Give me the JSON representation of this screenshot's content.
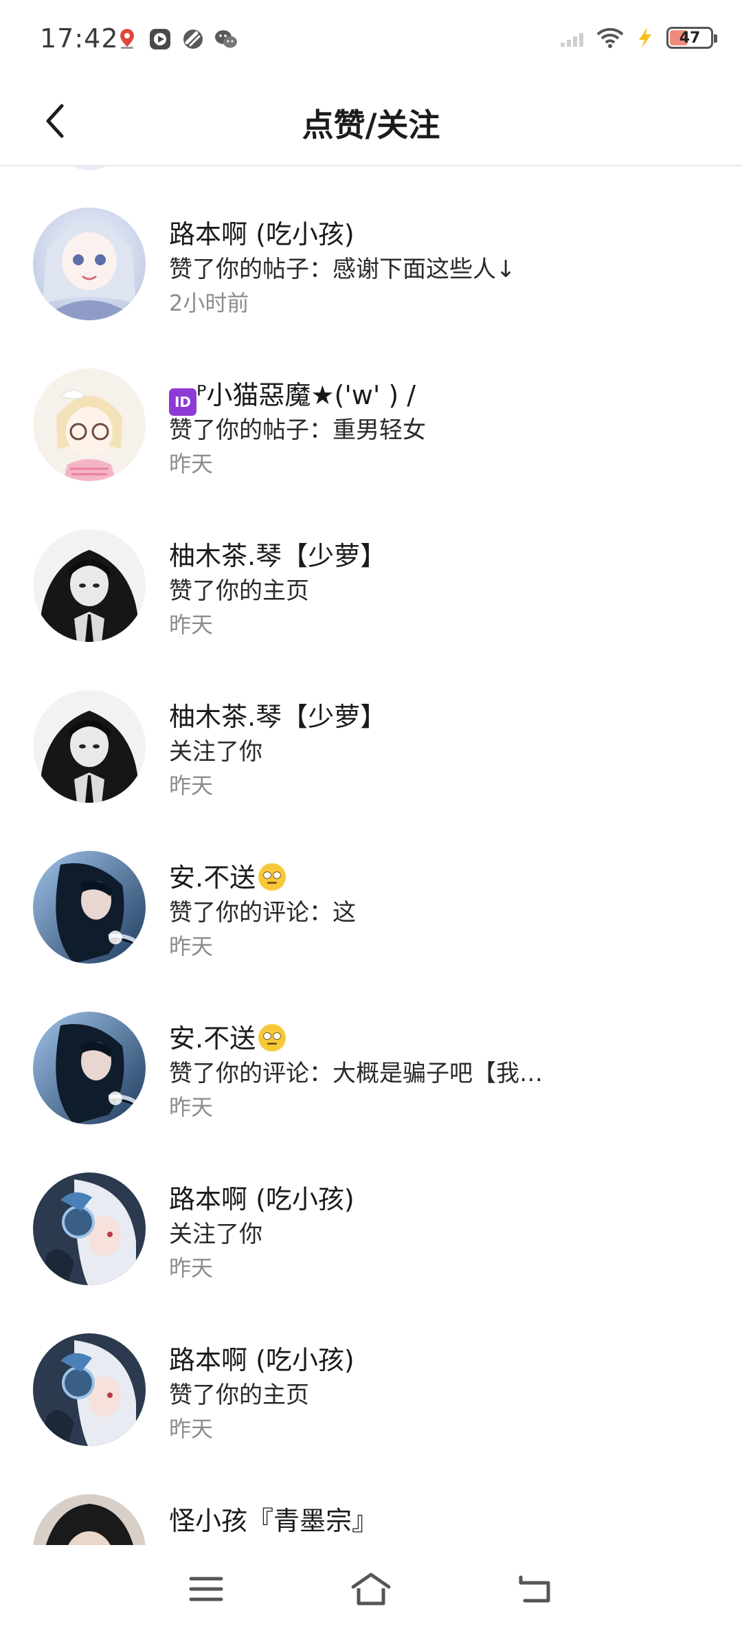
{
  "status_bar": {
    "time": "17:42",
    "battery": "47",
    "left_icons": [
      "location-icon",
      "video-app-icon",
      "capsule-app-icon",
      "wechat-icon"
    ],
    "right_icons": [
      "signal-icon",
      "wifi-icon",
      "charging-icon",
      "battery-icon"
    ]
  },
  "header": {
    "title": "点赞/关注",
    "back_icon": "chevron-left-icon"
  },
  "colors": {
    "text_primary": "#1a1a1a",
    "text_secondary": "#8c8c8c",
    "divider": "#e8e8e8",
    "id_badge": "#8e3ad6"
  },
  "items": [
    {
      "name": "路本啊 (吃小孩)",
      "action": "赞了你的帖子：感谢下面这些人↓",
      "time": "2小时前"
    },
    {
      "badge": "ID",
      "name": "ᴾ小猫惡魔★('w' ) /",
      "action": "赞了你的帖子：重男轻女",
      "time": "昨天"
    },
    {
      "name": "柚木茶.琴【少萝】",
      "action": "赞了你的主页",
      "time": "昨天"
    },
    {
      "name": "柚木茶.琴【少萝】",
      "action": "关注了你",
      "time": "昨天"
    },
    {
      "name": "安.不送",
      "emoji": "rolling-eyes-emoji",
      "action": "赞了你的评论：这",
      "time": "昨天"
    },
    {
      "name": "安.不送",
      "emoji": "rolling-eyes-emoji",
      "action": "赞了你的评论：大概是骗子吧【我…",
      "time": "昨天"
    },
    {
      "name": "路本啊 (吃小孩)",
      "action": "关注了你",
      "time": "昨天"
    },
    {
      "name": "路本啊 (吃小孩)",
      "action": "赞了你的主页",
      "time": "昨天"
    },
    {
      "name": "怪小孩『青墨宗』",
      "action": "",
      "time": ""
    }
  ],
  "nav_bar": {
    "icons": [
      "menu-icon",
      "home-icon",
      "back-icon"
    ]
  }
}
